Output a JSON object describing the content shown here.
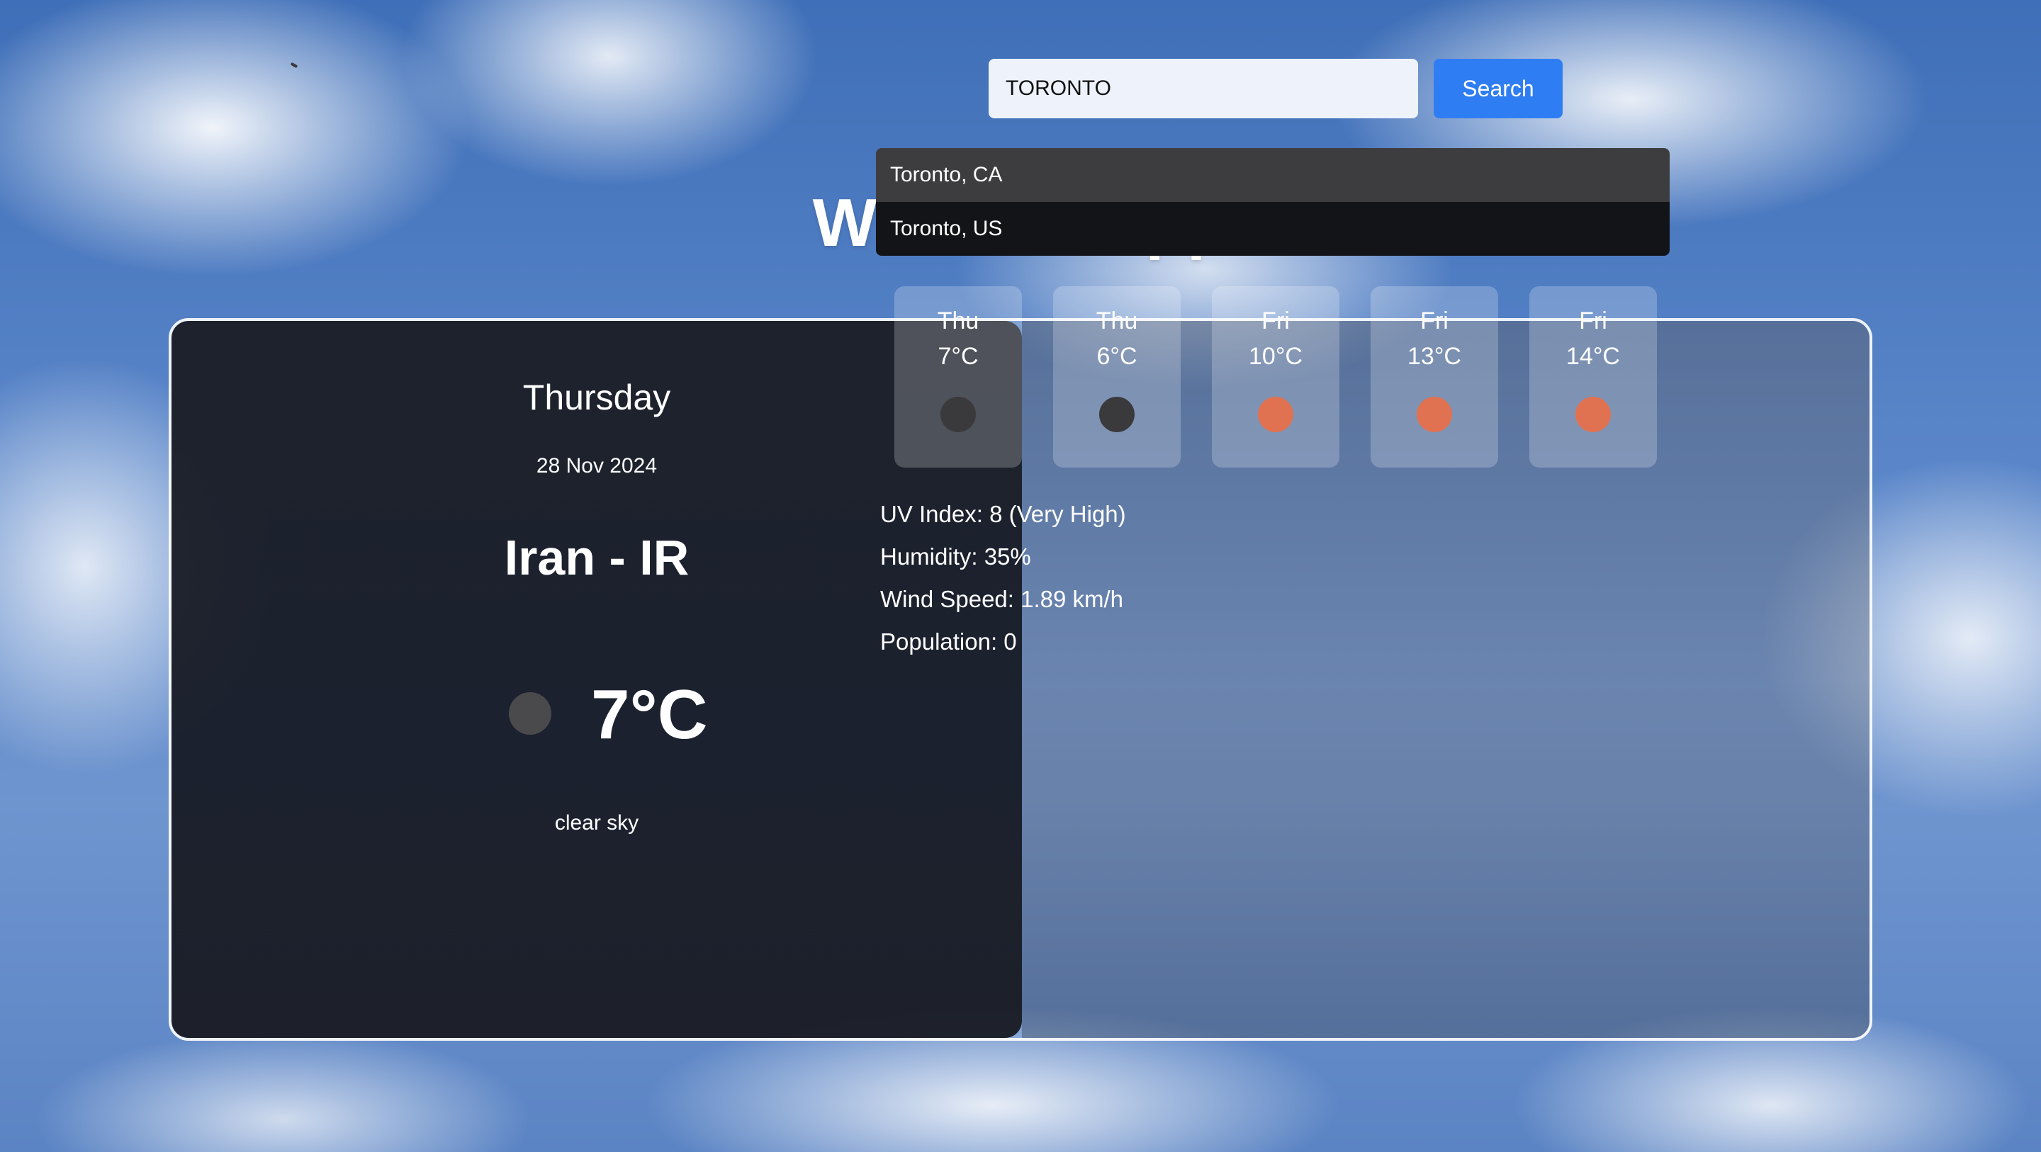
{
  "app": {
    "title": "Weather App"
  },
  "current": {
    "day": "Thursday",
    "date": "28 Nov 2024",
    "location": "Iran - IR",
    "temperature": "7°C",
    "condition": "clear sky",
    "icon": "moon-icon"
  },
  "search": {
    "value": "TORONTO",
    "button_label": "Search"
  },
  "suggestions": [
    {
      "label": "Toronto, CA"
    },
    {
      "label": "Toronto, US"
    }
  ],
  "forecast": [
    {
      "day": "Thu",
      "temp": "7°C",
      "icon": "moon-icon",
      "icon_color": "#3a3a3c"
    },
    {
      "day": "Thu",
      "temp": "6°C",
      "icon": "moon-icon",
      "icon_color": "#3a3a3c"
    },
    {
      "day": "Fri",
      "temp": "10°C",
      "icon": "sun-icon",
      "icon_color": "#e07252"
    },
    {
      "day": "Fri",
      "temp": "13°C",
      "icon": "sun-icon",
      "icon_color": "#e07252"
    },
    {
      "day": "Fri",
      "temp": "14°C",
      "icon": "sun-icon",
      "icon_color": "#e07252"
    }
  ],
  "details": {
    "uv_index": "UV Index: 8 (Very High)",
    "humidity": "Humidity: 35%",
    "wind_speed": "Wind Speed: 1.89 km/h",
    "population": "Population: 0"
  },
  "colors": {
    "accent": "#2f7df3",
    "panel_dark": "#1c1e26"
  }
}
